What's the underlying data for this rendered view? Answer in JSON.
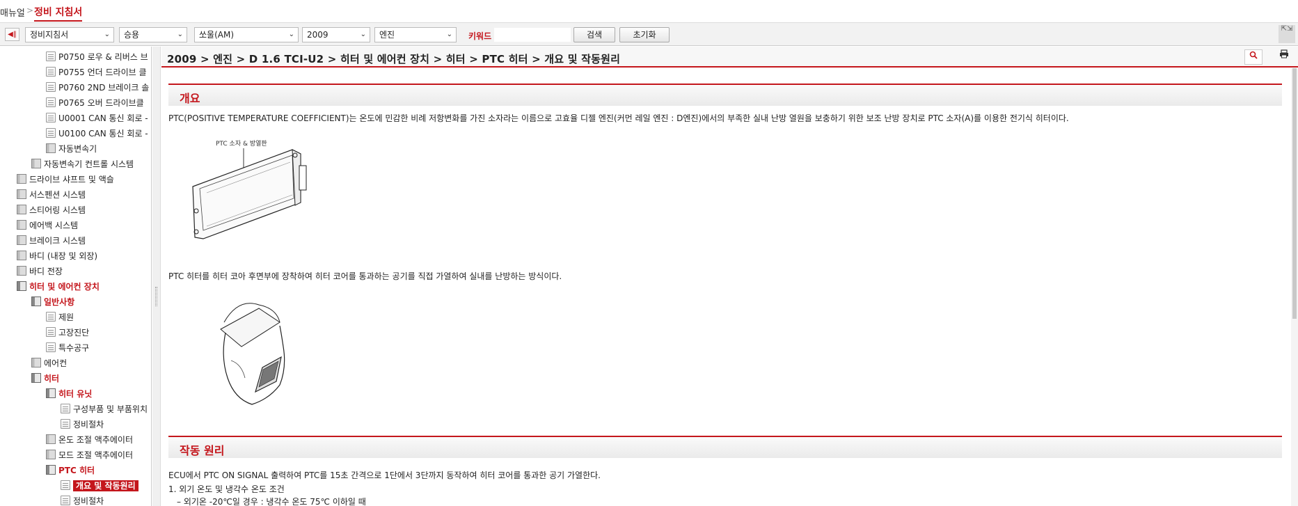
{
  "topbar": {
    "crumb1": "매뉴얼",
    "separator": ">",
    "crumb2": "정비 지침서"
  },
  "toolbar": {
    "collapse_icon": "◀‖",
    "selects": [
      "정비지침서",
      "승용",
      "쏘울(AM)",
      "2009",
      "엔진"
    ],
    "keyword_label": "키워드",
    "keyword_value": "",
    "search_label": "검색",
    "reset_label": "초기화",
    "expand_icon": "⇱⇲"
  },
  "sidebar": {
    "items": [
      {
        "label": "P0750 로우 & 리버스 브",
        "icon": "doc",
        "state": ""
      },
      {
        "label": "P0755 언더 드라이브 클",
        "icon": "doc",
        "state": ""
      },
      {
        "label": "P0760 2ND 브레이크 솔",
        "icon": "doc",
        "state": ""
      },
      {
        "label": "P0765 오버 드라이브클",
        "icon": "doc",
        "state": ""
      },
      {
        "label": "U0001 CAN 통신 회로 -",
        "icon": "doc",
        "state": ""
      },
      {
        "label": "U0100 CAN 통신 회로 -",
        "icon": "doc",
        "state": ""
      },
      {
        "label": "자동변속기",
        "icon": "book",
        "state": ""
      },
      {
        "label": "자동변속기 컨트롤 시스템",
        "icon": "book",
        "state": ""
      },
      {
        "label": "드라이브 샤프트 및 액슬",
        "icon": "book",
        "state": ""
      },
      {
        "label": "서스펜션 시스템",
        "icon": "book",
        "state": ""
      },
      {
        "label": "스티어링 시스템",
        "icon": "book",
        "state": ""
      },
      {
        "label": "에어백 시스템",
        "icon": "book",
        "state": ""
      },
      {
        "label": "브레이크 시스템",
        "icon": "book",
        "state": ""
      },
      {
        "label": "바디 (내장 및 외장)",
        "icon": "book",
        "state": ""
      },
      {
        "label": "바디 전장",
        "icon": "book",
        "state": ""
      },
      {
        "label": "히터 및 에어컨 장치",
        "icon": "book-open",
        "state": "active"
      },
      {
        "label": "일반사항",
        "icon": "book-open",
        "state": "active"
      },
      {
        "label": "제원",
        "icon": "doc",
        "state": ""
      },
      {
        "label": "고장진단",
        "icon": "doc",
        "state": ""
      },
      {
        "label": "특수공구",
        "icon": "doc",
        "state": ""
      },
      {
        "label": "에어컨",
        "icon": "book",
        "state": ""
      },
      {
        "label": "히터",
        "icon": "book-open",
        "state": "active"
      },
      {
        "label": "히터 유닛",
        "icon": "book-open",
        "state": "active"
      },
      {
        "label": "구성부품 및 부품위치",
        "icon": "doc",
        "state": ""
      },
      {
        "label": "정비절차",
        "icon": "doc",
        "state": ""
      },
      {
        "label": "온도 조절 액추에이터",
        "icon": "book",
        "state": ""
      },
      {
        "label": "모드 조절 액추에이터",
        "icon": "book",
        "state": ""
      },
      {
        "label": "PTC 히터",
        "icon": "book-open",
        "state": "active"
      },
      {
        "label": "개요 및 작동원리",
        "icon": "doc",
        "state": "selected"
      },
      {
        "label": "정비절차",
        "icon": "doc",
        "state": ""
      }
    ]
  },
  "content_header": {
    "path": "2009 > 엔진 > D 1.6 TCI-U2 > 히터 및 에어컨 장치 > 히터 > PTC 히터 > 개요 및 작동원리",
    "search_icon": "🔍",
    "print_icon": "⎙"
  },
  "content": {
    "section1_title": "개요",
    "para1": "PTC(POSITIVE TEMPERATURE COEFFICIENT)는 온도에 민감한 비례 저항변화를 가진 소자라는 이름으로 고효율 디젤 엔진(커먼 레일 엔진 : D엔진)에서의 부족한 실내 난방 열원을 보충하기 위한 보조 난방 장치로 PTC 소자(A)를 이용한 전기식 히터이다.",
    "figure1_label": "PTC 소자 & 방열판",
    "para2": "PTC 히터를 히터 코아 후면부에 장착하여 히터 코어를 통과하는 공기를 직접 가열하여 실내를 난방하는 방식이다.",
    "section2_title": "작동 원리",
    "para3": "ECU에서 PTC ON SIGNAL 출력하여 PTC를 15초 간격으로 1단에서 3단까지 동작하여 히터 코어를 통과한 공기 가열한다.",
    "para4": "1. 외기 온도 및 냉각수 온도 조건",
    "para5": "– 외기온 -20℃일 경우 : 냉각수 온도 75℃ 이하일 때"
  }
}
